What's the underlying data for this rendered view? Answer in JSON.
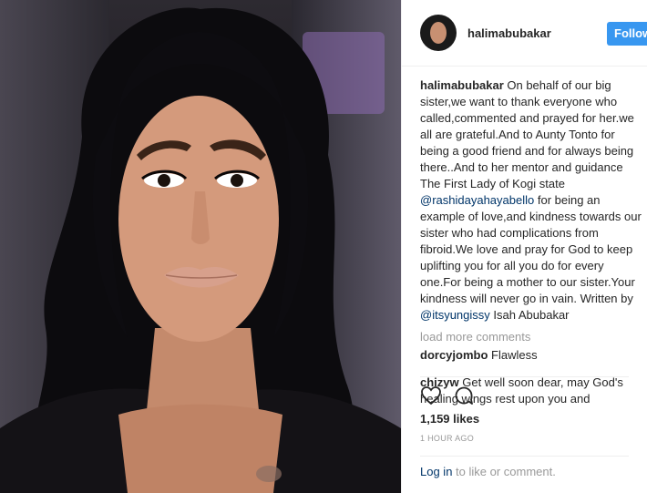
{
  "post": {
    "username": "halimabubakar",
    "follow_label": "Follow",
    "caption": {
      "user": "halimabubakar",
      "text_1": " On behalf of our big sister,we want to thank everyone who called,commented and prayed for her.we all are grateful.And to Aunty Tonto for being a good friend and for always being there..And to her mentor and guidance The First Lady of Kogi state ",
      "mention_1": "@rashidayahayabello",
      "text_2": " for being an example of love,and kindness towards our sister who had complications from fibroid.We love and pray for God to keep uplifting you for all you do for every one.For being a mother to our sister.Your kindness will never go in vain. Written by ",
      "mention_2": "@itsyungissy",
      "text_3": " Isah Abubakar"
    },
    "load_more": "load more comments",
    "comments": [
      {
        "user": "dorcyjombo",
        "text": " Flawless"
      },
      {
        "user": "chizyw",
        "text": " Get well soon dear, may God's healing wings rest upon you and strengthen your mortal body IJN"
      }
    ],
    "likes": "1,159 likes",
    "time": "1 HOUR AGO",
    "login": {
      "link": "Log in",
      "text": " to like or comment."
    }
  },
  "icons": [
    "heart-icon",
    "comment-icon"
  ]
}
